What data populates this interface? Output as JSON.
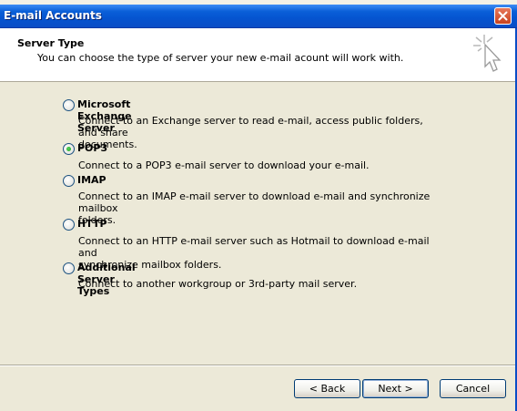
{
  "window": {
    "title": "E-mail Accounts"
  },
  "header": {
    "title": "Server Type",
    "subtitle": "You can choose the type of server your new e-mail acount will work with."
  },
  "options": [
    {
      "label": "Microsoft Exchange Server",
      "description_lines": [
        "Connect to an Exchange server to read e-mail, access public folders, and share",
        "documents."
      ],
      "selected": false
    },
    {
      "label": "POP3",
      "description_lines": [
        "Connect to a POP3 e-mail server to download your e-mail."
      ],
      "selected": true
    },
    {
      "label": "IMAP",
      "description_lines": [
        "Connect to an IMAP e-mail server to download e-mail and synchronize mailbox",
        "folders."
      ],
      "selected": false
    },
    {
      "label": "HTTP",
      "description_lines": [
        "Connect to an HTTP e-mail server such as Hotmail to download e-mail and",
        "synchronize mailbox folders."
      ],
      "selected": false
    },
    {
      "label": "Additional Server Types",
      "description_lines": [
        "Connect to another workgroup or 3rd-party mail server."
      ],
      "selected": false
    }
  ],
  "buttons": {
    "back": "< Back",
    "next": "Next >",
    "cancel": "Cancel"
  },
  "icons": {
    "close": "close-icon",
    "wizard": "wizard-cursor-icon"
  },
  "colors": {
    "titlebar": "#0554d0",
    "dialog_bg": "#ece9d8",
    "selected_radio": "#21a121"
  }
}
